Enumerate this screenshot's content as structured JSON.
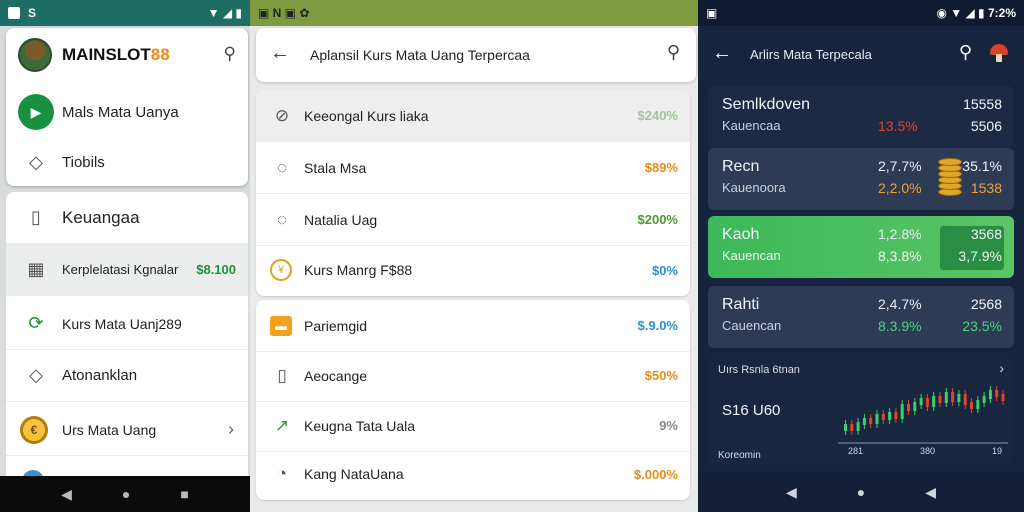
{
  "colors": {
    "green": "#1f8f3b",
    "orange": "#e98c18",
    "red": "#e0452c",
    "blue": "#2b8fd6",
    "dark_navy": "#17243d"
  },
  "panel1": {
    "status": {
      "left": "S",
      "right": "▼ ◢ ▮"
    },
    "brand": {
      "prefix": "MAINSLOT",
      "suffix": "88"
    },
    "top_items": [
      {
        "label": "Mals Mata Uanya",
        "icon": "play-icon"
      },
      {
        "label": "Tiobils",
        "icon": "diamond-icon"
      }
    ],
    "list_items": [
      {
        "label": "Keuangaa",
        "icon": "document-icon",
        "value": ""
      },
      {
        "label": "Kerplelatasi Kgnalar",
        "icon": "grid-icon",
        "value": "$8.100"
      },
      {
        "label": "Kurs Mata Uanj289",
        "icon": "exchange-icon",
        "value": ""
      },
      {
        "label": "Atonanklan",
        "icon": "diamond-icon",
        "value": ""
      },
      {
        "label": "Urs Mata Uang",
        "icon": "coin-icon",
        "value": ""
      }
    ],
    "nav": {
      "back": "◀",
      "home": "●",
      "recent": "■"
    }
  },
  "panel2": {
    "status": {
      "icons": "▣ N ▣ ✿"
    },
    "title": "Aplansil Kurs Mata Uang Terpercaa",
    "card1": [
      {
        "label": "Keeongal Kurs liaka",
        "value": "$240%",
        "value_color": "#9cc59a"
      },
      {
        "label": "Stala Msa",
        "value": "$89%",
        "value_color": "#e98c18"
      },
      {
        "label": "Natalia Uag",
        "value": "$200%",
        "value_color": "#4c9a34"
      },
      {
        "label": "Kurs Manrg F$88",
        "value": "$0%",
        "value_color": "#2b8fd6"
      }
    ],
    "card2": [
      {
        "label": "Pariemgid",
        "value": "$.9.0%",
        "value_color": "#2b8fd6"
      },
      {
        "label": "Aeocange",
        "value": "$50%",
        "value_color": "#e98c18"
      },
      {
        "label": "Keugna Tata Uala",
        "value": "9%",
        "value_color": "#888888"
      },
      {
        "label": "Kang NataUana",
        "value": "$.000%",
        "value_color": "#e98c18"
      }
    ]
  },
  "panel3": {
    "status": {
      "left": "▣",
      "right": "◉ ▼ ◢ ▮ 7:2%"
    },
    "title": "Arlirs Mata Terpecala",
    "cards": [
      {
        "name": "Semlkdoven",
        "sub": "Kauencaa",
        "v1": "",
        "v2": "13.5%",
        "v2_color": "#e0452c",
        "r1": "15558",
        "r2": "5506",
        "r2_color": "#f2f5f9"
      },
      {
        "name": "Recn",
        "sub": "Kauenoora",
        "v1": "2,7.7%",
        "v2": "2,2.0%",
        "v2_color": "#f0a03a",
        "r1": "35.1%",
        "r2": "1538",
        "r2_color": "#f0a03a"
      },
      {
        "name": "Kaoh",
        "sub": "Kauencan",
        "v1": "1,2.8%",
        "v2": "8,3.8%",
        "v2_color": "#eef8ee",
        "r1": "3568",
        "r2": "3,7.9%",
        "r2_color": "#eef8ee"
      },
      {
        "name": "Rahti",
        "sub": "Cauencan",
        "v1": "2,4.7%",
        "v2": "8.3.9%",
        "v2_color": "#4fd27a",
        "r1": "2568",
        "r2": "23.5%",
        "r2_color": "#4fd27a"
      }
    ],
    "chart": {
      "title": "Uırs Rsnla 6tnan",
      "value": "S16 U60",
      "label": "Koreomin",
      "ticks": [
        "281",
        "380",
        "19"
      ]
    },
    "nav": {
      "back": "◀",
      "home": "●",
      "recent": "◀"
    }
  }
}
